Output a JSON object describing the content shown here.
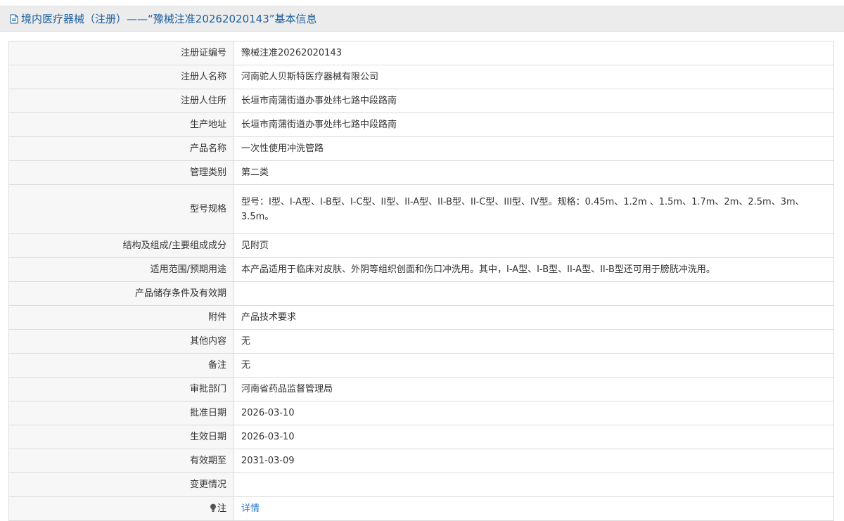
{
  "header": {
    "title": "境内医疗器械（注册）——“豫械注准20262020143”基本信息",
    "icon": "document-icon"
  },
  "rows": [
    {
      "label": "注册证编号",
      "value": "豫械注准20262020143"
    },
    {
      "label": "注册人名称",
      "value": "河南驼人贝斯特医疗器械有限公司"
    },
    {
      "label": "注册人住所",
      "value": "长垣市南蒲街道办事处纬七路中段路南"
    },
    {
      "label": "生产地址",
      "value": "长垣市南蒲街道办事处纬七路中段路南"
    },
    {
      "label": "产品名称",
      "value": "一次性使用冲洗管路"
    },
    {
      "label": "管理类别",
      "value": "第二类"
    },
    {
      "label": "型号规格",
      "value": "型号：I型、I-A型、I-B型、I-C型、II型、II-A型、II-B型、II-C型、III型、IV型。规格：0.45m、1.2m 、1.5m、1.7m、2m、2.5m、3m、3.5m。"
    },
    {
      "label": "结构及组成/主要组成成分",
      "value": "见附页"
    },
    {
      "label": "适用范围/预期用途",
      "value": "本产品适用于临床对皮肤、外阴等组织创面和伤口冲洗用。其中，I-A型、I-B型、II-A型、II-B型还可用于膀胱冲洗用。"
    },
    {
      "label": "产品储存条件及有效期",
      "value": ""
    },
    {
      "label": "附件",
      "value": "产品技术要求"
    },
    {
      "label": "其他内容",
      "value": "无"
    },
    {
      "label": "备注",
      "value": "无"
    },
    {
      "label": "审批部门",
      "value": "河南省药品监督管理局"
    },
    {
      "label": "批准日期",
      "value": "2026-03-10"
    },
    {
      "label": "生效日期",
      "value": "2026-03-10"
    },
    {
      "label": "有效期至",
      "value": "2031-03-09"
    },
    {
      "label": "变更情况",
      "value": ""
    }
  ],
  "note_row": {
    "label": "注",
    "icon": "lightbulb-icon",
    "link_text": "详情",
    "link_color": "#2b7bc8"
  },
  "colors": {
    "header_text": "#1c5f9e",
    "header_bg": "#ececec",
    "label_bg": "#f7f7f7",
    "border": "#dcdcdc"
  }
}
